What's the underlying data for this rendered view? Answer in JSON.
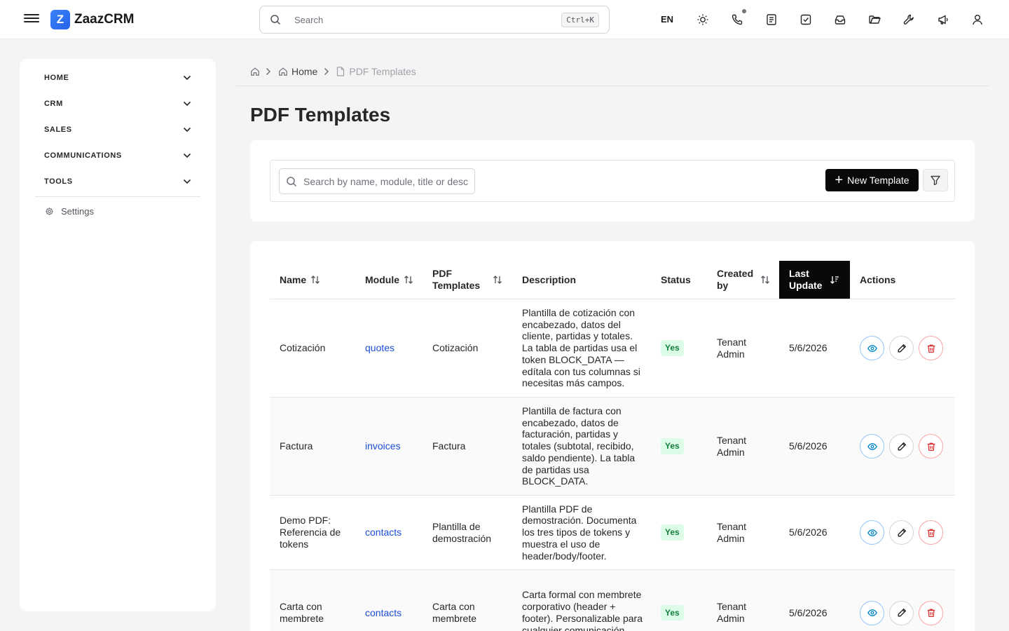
{
  "app": {
    "logo_letter": "Z",
    "name": "ZaazCRM"
  },
  "topbar": {
    "search_placeholder": "Search",
    "search_shortcut": "Ctrl+K",
    "language": "EN",
    "icons": [
      "sun-icon",
      "phone-icon",
      "notes-icon",
      "tasks-icon",
      "inbox-icon",
      "folder-icon",
      "tools-icon",
      "megaphone-icon",
      "user-icon"
    ]
  },
  "sidebar": {
    "items": [
      {
        "label": "HOME"
      },
      {
        "label": "CRM"
      },
      {
        "label": "SALES"
      },
      {
        "label": "COMMUNICATIONS"
      },
      {
        "label": "TOOLS"
      }
    ],
    "settings_label": "Settings"
  },
  "breadcrumb": {
    "home": "Home",
    "current": "PDF Templates"
  },
  "page": {
    "title": "PDF Templates"
  },
  "toolbar": {
    "search_placeholder": "Search by name, module, title or description",
    "new_button": "New Template"
  },
  "table": {
    "columns": [
      {
        "label": "Name",
        "sortable": true
      },
      {
        "label": "Module",
        "sortable": true
      },
      {
        "label": "PDF Templates",
        "sortable": true
      },
      {
        "label": "Description",
        "sortable": false
      },
      {
        "label": "Status",
        "sortable": false
      },
      {
        "label": "Created by",
        "sortable": true
      },
      {
        "label": "Last Update",
        "sortable": true,
        "active": true
      },
      {
        "label": "Actions",
        "sortable": false
      }
    ],
    "rows": [
      {
        "name": "Cotización",
        "module": "quotes",
        "template": "Cotización",
        "description": "Plantilla de cotización con encabezado, datos del cliente, partidas y totales. La tabla de partidas usa el token BLOCK_DATA — edítala con tus columnas si necesitas más campos.",
        "status": "Yes",
        "created_by": "Tenant Admin",
        "last_update": "5/6/2026"
      },
      {
        "name": "Factura",
        "module": "invoices",
        "template": "Factura",
        "description": "Plantilla de factura con encabezado, datos de facturación, partidas y totales (subtotal, recibido, saldo pendiente). La tabla de partidas usa BLOCK_DATA.",
        "status": "Yes",
        "created_by": "Tenant Admin",
        "last_update": "5/6/2026"
      },
      {
        "name": "Demo PDF: Referencia de tokens",
        "module": "contacts",
        "template": "Plantilla de demostración",
        "description": "Plantilla PDF de demostración. Documenta los tres tipos de tokens y muestra el uso de header/body/footer.",
        "status": "Yes",
        "created_by": "Tenant Admin",
        "last_update": "5/6/2026"
      },
      {
        "name": "Carta con membrete",
        "module": "contacts",
        "template": "Carta con membrete",
        "description": "Carta formal con membrete corporativo (header + footer). Personalizable para cualquier comunicación.",
        "status": "Yes",
        "created_by": "Tenant Admin",
        "last_update": "5/6/2026"
      }
    ]
  },
  "colors": {
    "accent": "#2563eb",
    "primary_button": "#09090b",
    "status_badge_bg": "#dcfce7",
    "status_badge_text": "#15803d",
    "link": "#1d4ed8"
  }
}
